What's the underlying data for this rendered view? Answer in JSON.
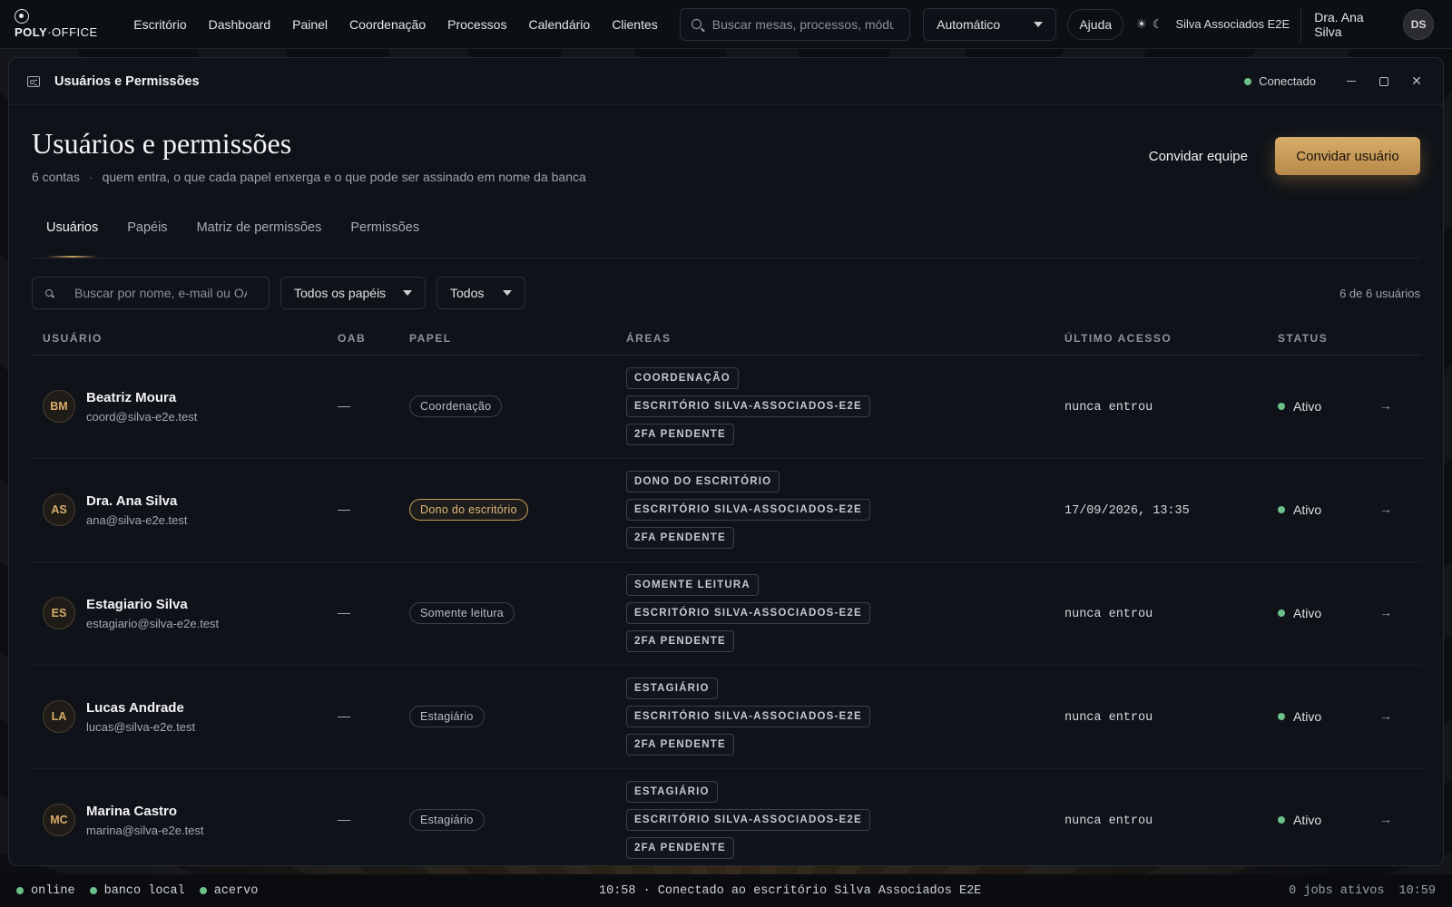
{
  "brand": {
    "logo_bold": "POLY",
    "logo_thin": "·OFFICE"
  },
  "nav": [
    "Escritório",
    "Dashboard",
    "Painel",
    "Coordenação",
    "Processos",
    "Calendário",
    "Clientes"
  ],
  "search": {
    "placeholder": "Buscar mesas, processos, módulos"
  },
  "mode_select": {
    "value": "Automático"
  },
  "help_label": "Ajuda",
  "theme_icons": {
    "sun": "☀",
    "moon": "☾"
  },
  "org_name": "Silva Associados E2E",
  "current_user": {
    "name": "Dra. Ana Silva",
    "initials": "DS"
  },
  "window": {
    "title": "Usuários e Permissões",
    "connection": "Conectado"
  },
  "page": {
    "title": "Usuários e permissões",
    "accounts": "6 contas",
    "separator": "·",
    "description": "quem entra, o que cada papel enxerga e o que pode ser assinado em nome da banca",
    "invite_team": "Convidar equipe",
    "invite_user": "Convidar usuário"
  },
  "tabs": [
    "Usuários",
    "Papéis",
    "Matriz de permissões",
    "Permissões"
  ],
  "filters": {
    "search_placeholder": "Buscar por nome, e-mail ou OAB",
    "roles": "Todos os papéis",
    "status": "Todos",
    "count": "6 de 6 usuários"
  },
  "table": {
    "headers": [
      "USUÁRIO",
      "OAB",
      "PAPEL",
      "ÁREAS",
      "ÚLTIMO ACESSO",
      "STATUS"
    ],
    "rows": [
      {
        "initials": "BM",
        "name": "Beatriz Moura",
        "email": "coord@silva-e2e.test",
        "oab": "—",
        "role": "Coordenação",
        "owner": false,
        "areas": [
          "COORDENAÇÃO",
          "ESCRITÓRIO SILVA-ASSOCIADOS-E2E",
          "2FA PENDENTE"
        ],
        "last": "nunca entrou",
        "status": "Ativo"
      },
      {
        "initials": "AS",
        "name": "Dra. Ana Silva",
        "email": "ana@silva-e2e.test",
        "oab": "—",
        "role": "Dono do escritório",
        "owner": true,
        "areas": [
          "DONO DO ESCRITÓRIO",
          "ESCRITÓRIO SILVA-ASSOCIADOS-E2E",
          "2FA PENDENTE"
        ],
        "last": "17/09/2026, 13:35",
        "status": "Ativo"
      },
      {
        "initials": "ES",
        "name": "Estagiario Silva",
        "email": "estagiario@silva-e2e.test",
        "oab": "—",
        "role": "Somente leitura",
        "owner": false,
        "areas": [
          "SOMENTE LEITURA",
          "ESCRITÓRIO SILVA-ASSOCIADOS-E2E",
          "2FA PENDENTE"
        ],
        "last": "nunca entrou",
        "status": "Ativo"
      },
      {
        "initials": "LA",
        "name": "Lucas Andrade",
        "email": "lucas@silva-e2e.test",
        "oab": "—",
        "role": "Estagiário",
        "owner": false,
        "areas": [
          "ESTAGIÁRIO",
          "ESCRITÓRIO SILVA-ASSOCIADOS-E2E",
          "2FA PENDENTE"
        ],
        "last": "nunca entrou",
        "status": "Ativo"
      },
      {
        "initials": "MC",
        "name": "Marina Castro",
        "email": "marina@silva-e2e.test",
        "oab": "—",
        "role": "Estagiário",
        "owner": false,
        "areas": [
          "ESTAGIÁRIO",
          "ESCRITÓRIO SILVA-ASSOCIADOS-E2E",
          "2FA PENDENTE"
        ],
        "last": "nunca entrou",
        "status": "Ativo"
      }
    ]
  },
  "statusbar": {
    "left": [
      "online",
      "banco local",
      "acervo"
    ],
    "center": "10:58 · Conectado ao escritório Silva Associados E2E",
    "jobs": "0 jobs ativos",
    "clock": "10:59"
  },
  "colors": {
    "accent_gold": "#c89a57",
    "status_green": "#6cc08a",
    "background": "#0f1319"
  }
}
